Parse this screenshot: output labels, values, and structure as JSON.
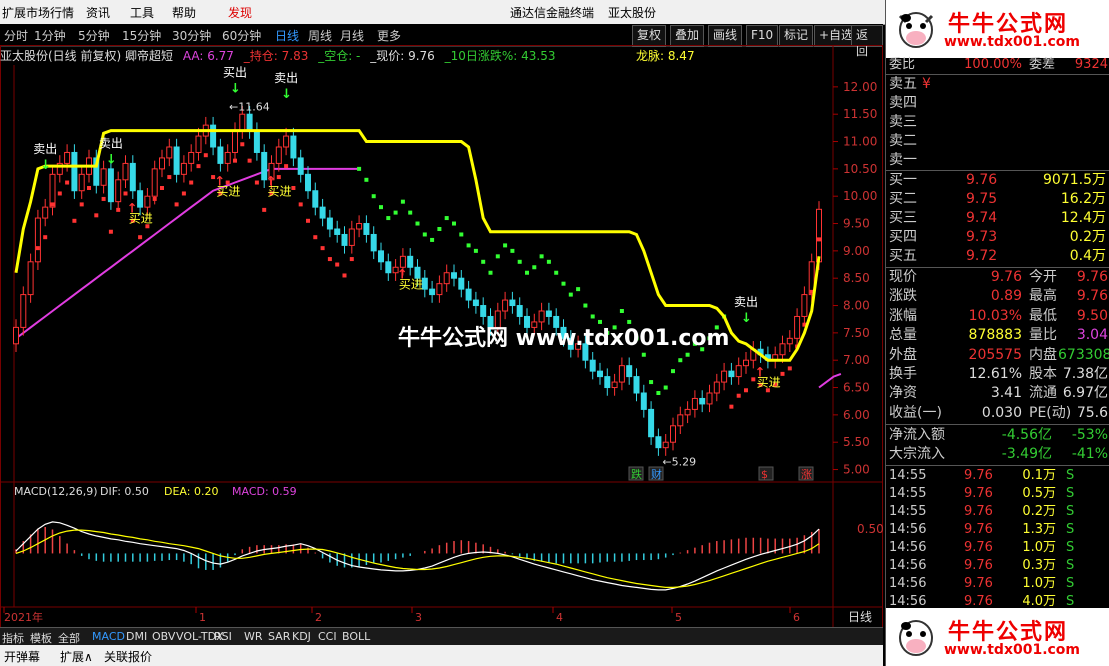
{
  "menubar": {
    "items": [
      "扩展市场行情",
      "资讯",
      "工具",
      "帮助",
      "发现"
    ],
    "center_title": "通达信金融终端",
    "stock_name": "亚太股份"
  },
  "toolbar": {
    "periods": [
      "分时",
      "1分钟",
      "5分钟",
      "15分钟",
      "30分钟",
      "60分钟",
      "日线",
      "周线",
      "月线",
      "更多"
    ],
    "selected_period": "日线",
    "buttons": [
      "复权",
      "叠加",
      "画线",
      "F10",
      "标记",
      "+自选",
      "返回"
    ]
  },
  "infoline": {
    "title": "亚太股份(日线 前复权) 卿帝超短",
    "aa": "AA: 6.77",
    "hold": "_持仓: 7.83",
    "empty": "_空仓: -",
    "price": "_现价: 9.76",
    "rise10": "_10日涨跌%: 43.53",
    "dragon": "龙脉: 8.47"
  },
  "chart_data": [
    {
      "type": "candlestick",
      "title": "亚太股份(日线 前复权) 卿帝超短",
      "price_axis": [
        "12.00",
        "11.50",
        "11.00",
        "10.50",
        "10.00",
        "9.50",
        "9.00",
        "8.50",
        "8.00",
        "7.50",
        "7.00",
        "6.50",
        "6.00",
        "5.50",
        "5.00"
      ],
      "ylim": [
        4.9,
        12.4
      ],
      "date_axis": [
        "2021年",
        "1",
        "2",
        "3",
        "4",
        "5",
        "6"
      ],
      "annotations": {
        "high_label": "11.64",
        "low_label": "5.29",
        "sell_labels": [
          "卖出",
          "卖出",
          "买出",
          "卖出",
          "卖出"
        ],
        "buy_labels": [
          "买进",
          "买进",
          "买进",
          "买进",
          "买进"
        ],
        "event_labels": [
          "跌",
          "财",
          "$",
          "涨"
        ]
      },
      "series": [
        {
          "name": "yellow_line",
          "color": "#ffff00",
          "values": [
            8.6,
            9.4,
            9.9,
            10.5,
            10.55,
            10.55,
            10.55,
            10.55,
            10.55,
            10.55,
            10.55,
            10.55,
            11.15,
            11.2,
            11.2,
            11.2,
            11.2,
            11.2,
            11.2,
            11.2,
            11.2,
            11.2,
            11.2,
            11.2,
            11.2,
            11.2,
            11.2,
            11.2,
            11.2,
            11.2,
            11.2,
            11.2,
            11.2,
            11.2,
            11.2,
            11.2,
            11.2,
            11.2,
            11.2,
            11.2,
            11.2,
            11.2,
            11.2,
            11.2,
            11.2,
            11.2,
            11.2,
            11.2,
            11.0,
            11.0,
            11.0,
            11.0,
            11.0,
            11.0,
            11.0,
            11.0,
            11.0,
            11.0,
            11.0,
            11.0,
            11.0,
            11.0,
            10.9,
            10.3,
            9.6,
            9.35,
            9.35,
            9.35,
            9.35,
            9.35,
            9.35,
            9.35,
            9.35,
            9.35,
            9.35,
            9.35,
            9.35,
            9.35,
            9.35,
            9.35,
            9.35,
            9.35,
            9.35,
            9.35,
            9.35,
            9.3,
            9.0,
            8.6,
            8.2,
            8.0,
            8.0,
            8.0,
            8.0,
            8.0,
            8.0,
            8.0,
            7.95,
            7.8,
            7.5,
            7.35,
            7.3,
            7.2,
            7.1,
            7.0,
            7.0,
            7.0,
            7.0,
            7.2,
            7.5,
            7.9,
            8.9
          ]
        },
        {
          "name": "magenta_line",
          "color": "#e03ce0",
          "values": [
            7.4,
            7.5,
            7.6,
            7.7,
            7.8,
            7.9,
            8.0,
            8.1,
            8.2,
            8.3,
            8.4,
            8.5,
            8.6,
            8.7,
            8.8,
            8.9,
            9.0,
            9.1,
            9.2,
            9.3,
            9.4,
            9.5,
            9.6,
            9.7,
            9.8,
            9.9,
            10.0,
            10.1,
            10.15,
            10.2,
            10.25,
            10.3,
            10.35,
            10.4,
            10.45,
            10.5,
            10.5,
            10.5,
            10.5,
            10.5,
            10.5,
            10.5,
            10.5,
            10.5,
            10.5,
            10.5,
            10.5,
            10.5,
            null,
            null,
            null,
            null,
            null,
            null,
            null,
            null,
            null,
            null,
            null,
            null,
            null,
            null,
            null,
            null,
            null,
            null,
            null,
            null,
            null,
            null,
            null,
            null,
            null,
            null,
            null,
            null,
            null,
            null,
            null,
            null,
            null,
            null,
            null,
            null,
            null,
            null,
            null,
            null,
            null,
            null,
            null,
            null,
            null,
            null,
            null,
            null,
            null,
            null,
            null,
            null,
            null,
            null,
            null,
            null,
            null,
            null,
            null,
            null,
            null,
            null,
            6.5,
            6.6,
            6.7,
            6.75
          ]
        },
        {
          "name": "price_close",
          "color": "#36d9e8",
          "values": [
            7.6,
            8.2,
            8.8,
            9.6,
            9.8,
            10.4,
            10.6,
            10.8,
            10.1,
            10.4,
            10.7,
            10.2,
            10.5,
            9.9,
            10.3,
            10.6,
            10.1,
            9.8,
            10.0,
            10.5,
            10.7,
            10.9,
            10.4,
            10.6,
            10.8,
            11.1,
            11.3,
            10.9,
            10.6,
            10.8,
            11.2,
            11.5,
            11.2,
            10.8,
            10.3,
            10.6,
            10.9,
            11.1,
            10.7,
            10.4,
            10.1,
            9.8,
            9.6,
            9.4,
            9.3,
            9.1,
            9.4,
            9.5,
            9.3,
            9.0,
            8.8,
            8.6,
            8.7,
            8.9,
            8.7,
            8.5,
            8.3,
            8.2,
            8.4,
            8.6,
            8.5,
            8.3,
            8.1,
            8.0,
            7.8,
            7.6,
            7.9,
            8.1,
            8.0,
            7.8,
            7.6,
            7.7,
            7.9,
            7.8,
            7.6,
            7.4,
            7.2,
            7.3,
            7.0,
            6.8,
            6.7,
            6.5,
            6.6,
            6.9,
            6.7,
            6.4,
            6.1,
            5.6,
            5.4,
            5.5,
            5.8,
            6.0,
            6.1,
            6.3,
            6.2,
            6.4,
            6.6,
            6.8,
            6.7,
            6.9,
            7.0,
            7.2,
            7.1,
            7.0,
            7.1,
            7.3,
            7.4,
            7.8,
            8.2,
            8.8,
            9.76
          ]
        }
      ]
    },
    {
      "type": "bar",
      "title": "MACD(12,26,9)",
      "legend": [
        "DIF: 0.50",
        "DEA: 0.20",
        "MACD: 0.59"
      ],
      "y_axis": [
        "0.50"
      ],
      "ylim": [
        -1.0,
        1.1
      ],
      "series": [
        {
          "name": "DIF",
          "color": "#ffffff",
          "values": [
            0.05,
            0.2,
            0.35,
            0.5,
            0.6,
            0.65,
            0.63,
            0.58,
            0.52,
            0.45,
            0.4,
            0.36,
            0.33,
            0.3,
            0.28,
            0.25,
            0.23,
            0.2,
            0.18,
            0.16,
            0.14,
            0.12,
            0.1,
            0.06,
            0.0,
            -0.08,
            -0.15,
            -0.2,
            -0.22,
            -0.18,
            -0.12,
            -0.05,
            0.0,
            0.05,
            0.08,
            0.1,
            0.12,
            0.15,
            0.17,
            0.2,
            0.16,
            0.1,
            0.02,
            -0.06,
            -0.14,
            -0.2,
            -0.25,
            -0.28,
            -0.3,
            -0.32,
            -0.34,
            -0.35,
            -0.36,
            -0.36,
            -0.35,
            -0.33,
            -0.3,
            -0.26,
            -0.2,
            -0.14,
            -0.08,
            -0.03,
            0.0,
            0.02,
            0.03,
            0.02,
            0.0,
            -0.03,
            -0.07,
            -0.12,
            -0.17,
            -0.22,
            -0.26,
            -0.3,
            -0.34,
            -0.38,
            -0.42,
            -0.46,
            -0.5,
            -0.54,
            -0.57,
            -0.6,
            -0.63,
            -0.66,
            -0.68,
            -0.7,
            -0.72,
            -0.74,
            -0.75,
            -0.75,
            -0.72,
            -0.68,
            -0.63,
            -0.57,
            -0.5,
            -0.43,
            -0.36,
            -0.3,
            -0.24,
            -0.18,
            -0.12,
            -0.07,
            -0.02,
            0.02,
            0.06,
            0.1,
            0.14,
            0.19,
            0.26,
            0.36,
            0.5
          ]
        },
        {
          "name": "DEA",
          "color": "#ffff00",
          "values": [
            0.0,
            0.05,
            0.12,
            0.2,
            0.28,
            0.36,
            0.42,
            0.46,
            0.48,
            0.48,
            0.47,
            0.45,
            0.43,
            0.4,
            0.38,
            0.35,
            0.33,
            0.3,
            0.28,
            0.25,
            0.23,
            0.2,
            0.18,
            0.16,
            0.13,
            0.1,
            0.05,
            0.0,
            -0.05,
            -0.08,
            -0.1,
            -0.1,
            -0.08,
            -0.05,
            -0.02,
            0.0,
            0.02,
            0.04,
            0.06,
            0.08,
            0.09,
            0.09,
            0.08,
            0.05,
            0.01,
            -0.03,
            -0.08,
            -0.12,
            -0.16,
            -0.2,
            -0.23,
            -0.26,
            -0.29,
            -0.31,
            -0.32,
            -0.33,
            -0.33,
            -0.32,
            -0.3,
            -0.27,
            -0.23,
            -0.19,
            -0.15,
            -0.11,
            -0.08,
            -0.06,
            -0.05,
            -0.05,
            -0.06,
            -0.08,
            -0.1,
            -0.13,
            -0.16,
            -0.19,
            -0.22,
            -0.26,
            -0.3,
            -0.34,
            -0.38,
            -0.42,
            -0.46,
            -0.5,
            -0.53,
            -0.56,
            -0.59,
            -0.62,
            -0.64,
            -0.66,
            -0.68,
            -0.7,
            -0.7,
            -0.69,
            -0.67,
            -0.64,
            -0.6,
            -0.56,
            -0.51,
            -0.46,
            -0.41,
            -0.36,
            -0.31,
            -0.26,
            -0.21,
            -0.16,
            -0.12,
            -0.08,
            -0.04,
            0.0,
            0.04,
            0.1,
            0.2
          ]
        },
        {
          "name": "MACD",
          "color": "#ff4040",
          "values": [
            0.1,
            0.3,
            0.46,
            0.6,
            0.64,
            0.58,
            0.42,
            0.24,
            0.08,
            -0.06,
            -0.14,
            -0.18,
            -0.2,
            -0.2,
            -0.2,
            -0.2,
            -0.2,
            -0.2,
            -0.2,
            -0.18,
            -0.18,
            -0.16,
            -0.16,
            -0.2,
            -0.26,
            -0.36,
            -0.4,
            -0.4,
            -0.34,
            -0.2,
            -0.04,
            0.1,
            0.16,
            0.2,
            0.2,
            0.2,
            0.2,
            0.22,
            0.22,
            0.24,
            0.14,
            0.02,
            -0.12,
            -0.22,
            -0.3,
            -0.34,
            -0.34,
            -0.32,
            -0.28,
            -0.24,
            -0.22,
            -0.18,
            -0.14,
            -0.1,
            -0.06,
            0.0,
            0.06,
            0.12,
            0.2,
            0.26,
            0.3,
            0.32,
            0.3,
            0.26,
            0.22,
            0.16,
            0.1,
            0.04,
            -0.02,
            -0.08,
            -0.14,
            -0.18,
            -0.2,
            -0.22,
            -0.24,
            -0.24,
            -0.24,
            -0.24,
            -0.24,
            -0.24,
            -0.22,
            -0.2,
            -0.2,
            -0.2,
            -0.18,
            -0.16,
            -0.16,
            -0.16,
            -0.14,
            -0.1,
            -0.04,
            0.02,
            0.08,
            0.14,
            0.2,
            0.26,
            0.3,
            0.32,
            0.34,
            0.36,
            0.38,
            0.38,
            0.38,
            0.36,
            0.36,
            0.36,
            0.36,
            0.38,
            0.44,
            0.52,
            0.59
          ]
        }
      ]
    }
  ],
  "watermark": "牛牛公式网 www.tdx001.com",
  "period_label": "日线",
  "rightpanel": {
    "logo_title": "牛牛公式网",
    "logo_url": "www.tdx001.com",
    "top_row": {
      "l1": "委比",
      "v1": "100.00%",
      "l2": "委差",
      "v2": "9324"
    },
    "asks": [
      {
        "label": "卖五",
        "price": "¥",
        "vol": ""
      },
      {
        "label": "卖四",
        "price": "",
        "vol": ""
      },
      {
        "label": "卖三",
        "price": "",
        "vol": ""
      },
      {
        "label": "卖二",
        "price": "",
        "vol": ""
      },
      {
        "label": "卖一",
        "price": "",
        "vol": ""
      }
    ],
    "bids": [
      {
        "label": "买一",
        "price": "9.76",
        "vol": "9071.5万"
      },
      {
        "label": "买二",
        "price": "9.75",
        "vol": "16.2万"
      },
      {
        "label": "买三",
        "price": "9.74",
        "vol": "12.4万"
      },
      {
        "label": "买四",
        "price": "9.73",
        "vol": "0.2万"
      },
      {
        "label": "买五",
        "price": "9.72",
        "vol": "0.4万"
      }
    ],
    "stats": [
      {
        "l1": "现价",
        "v1": "9.76",
        "c1": "#e33",
        "l2": "今开",
        "v2": "9.76",
        "c2": "#e33"
      },
      {
        "l1": "涨跌",
        "v1": "0.89",
        "c1": "#e33",
        "l2": "最高",
        "v2": "9.76",
        "c2": "#e33"
      },
      {
        "l1": "涨幅",
        "v1": "10.03%",
        "c1": "#e33",
        "l2": "最低",
        "v2": "9.50",
        "c2": "#e33"
      },
      {
        "l1": "总量",
        "v1": "878883",
        "c1": "#ff3",
        "l2": "量比",
        "v2": "3.04",
        "c2": "#d4d"
      },
      {
        "l1": "外盘",
        "v1": "205575",
        "c1": "#e33",
        "l2": "内盘",
        "v2": "673308",
        "c2": "#3c3"
      },
      {
        "l1": "换手",
        "v1": "12.61%",
        "c1": "#ddd",
        "l2": "股本",
        "v2": "7.38亿",
        "c2": "#ddd"
      },
      {
        "l1": "净资",
        "v1": "3.41",
        "c1": "#ddd",
        "l2": "流通",
        "v2": "6.97亿",
        "c2": "#ddd"
      },
      {
        "l1": "收益(一)",
        "v1": "0.030",
        "c1": "#ddd",
        "l2": "PE(动)",
        "v2": "75.6",
        "c2": "#ddd"
      }
    ],
    "flows": [
      {
        "label": "净流入额",
        "v1": "-4.56亿",
        "v2": "-53%"
      },
      {
        "label": "大宗流入",
        "v1": "-3.49亿",
        "v2": "-41%"
      }
    ],
    "trades": [
      {
        "time": "14:55",
        "price": "9.76",
        "vol": "0.1万",
        "side": "S"
      },
      {
        "time": "14:55",
        "price": "9.76",
        "vol": "0.5万",
        "side": "S"
      },
      {
        "time": "14:55",
        "price": "9.76",
        "vol": "0.2万",
        "side": "S"
      },
      {
        "time": "14:56",
        "price": "9.76",
        "vol": "1.3万",
        "side": "S"
      },
      {
        "time": "14:56",
        "price": "9.76",
        "vol": "1.0万",
        "side": "S"
      },
      {
        "time": "14:56",
        "price": "9.76",
        "vol": "0.3万",
        "side": "S"
      },
      {
        "time": "14:56",
        "price": "9.76",
        "vol": "1.0万",
        "side": "S"
      },
      {
        "time": "14:56",
        "price": "9.76",
        "vol": "4.0万",
        "side": "S"
      }
    ]
  },
  "bottomtabs": [
    "指标",
    "模板",
    "全部",
    "MACD",
    "DMI",
    "OBV",
    "VOL-TDX",
    "RSI",
    "WR",
    "SAR",
    "KDJ",
    "CCI",
    "BOLL"
  ],
  "selected_tab": "MACD",
  "statusbar": [
    "开弹幕",
    "扩展∧",
    "关联报价"
  ],
  "colors": {
    "up": "#ff3333",
    "down": "#36d9e8",
    "sar_up": "#ff3333",
    "sar_down": "#33ff33",
    "accent": "#ffff00"
  }
}
